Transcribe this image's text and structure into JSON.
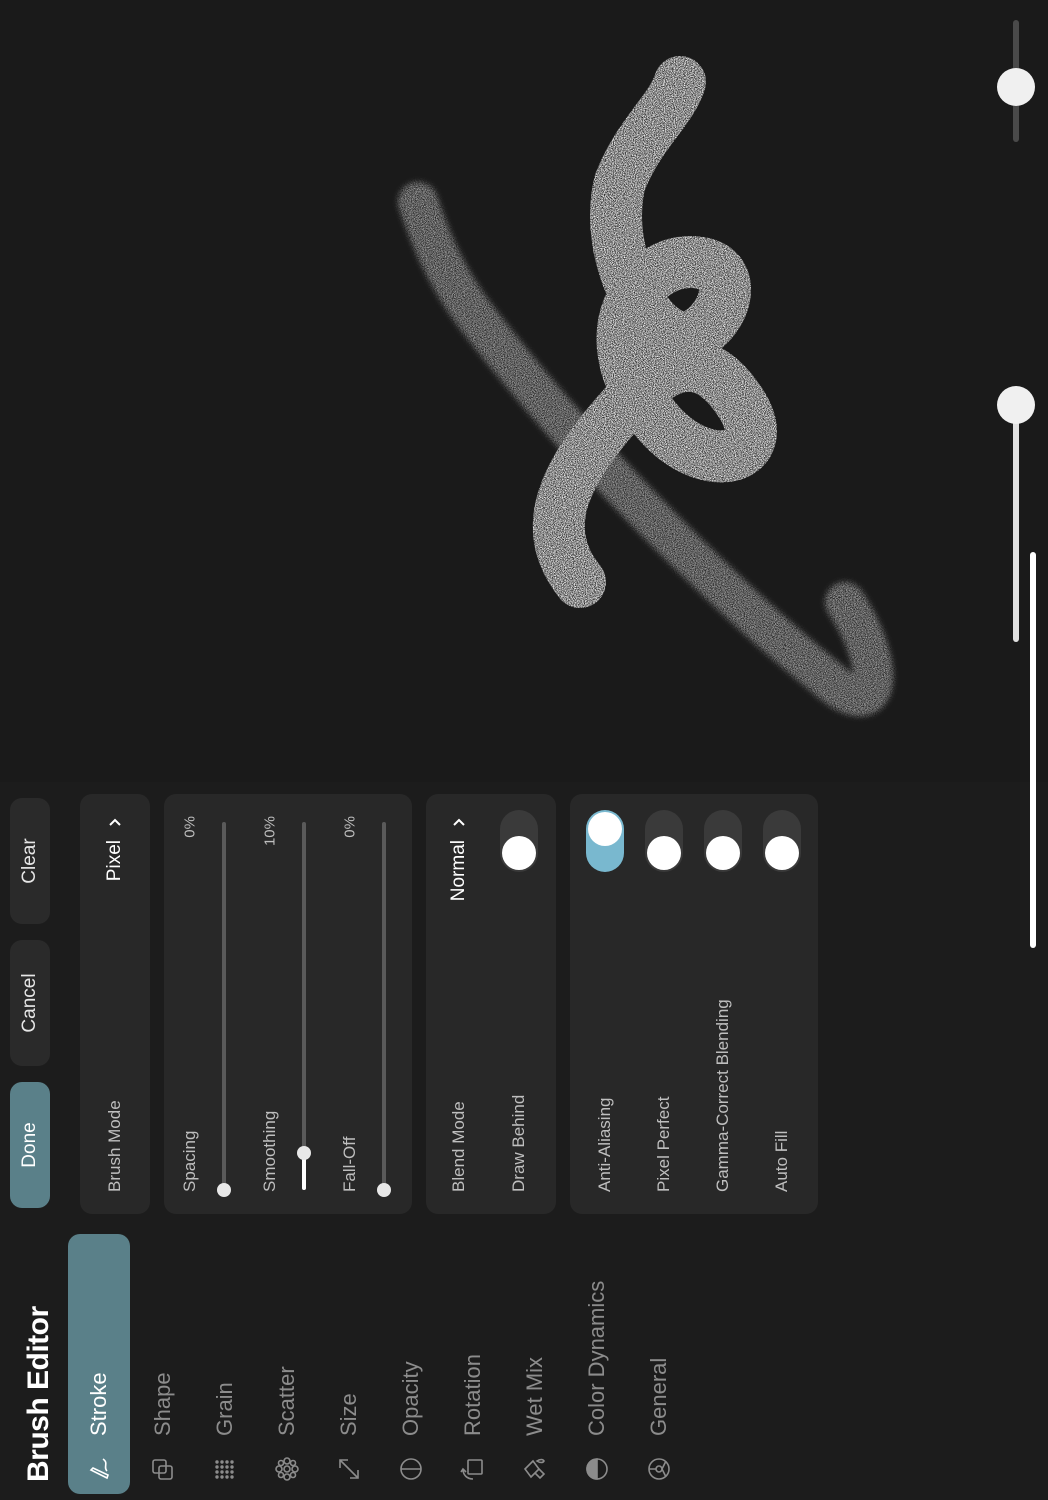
{
  "header": {
    "title": "Brush Editor"
  },
  "nav": {
    "items": [
      {
        "label": "Stroke",
        "icon": "stroke-icon",
        "active": true
      },
      {
        "label": "Shape",
        "icon": "shape-icon",
        "active": false
      },
      {
        "label": "Grain",
        "icon": "grain-icon",
        "active": false
      },
      {
        "label": "Scatter",
        "icon": "scatter-icon",
        "active": false
      },
      {
        "label": "Size",
        "icon": "size-icon",
        "active": false
      },
      {
        "label": "Opacity",
        "icon": "opacity-icon",
        "active": false
      },
      {
        "label": "Rotation",
        "icon": "rotation-icon",
        "active": false
      },
      {
        "label": "Wet Mix",
        "icon": "wet-mix-icon",
        "active": false
      },
      {
        "label": "Color Dynamics",
        "icon": "color-dynamics-icon",
        "active": false
      },
      {
        "label": "General",
        "icon": "general-icon",
        "active": false
      }
    ]
  },
  "actions": {
    "done": "Done",
    "cancel": "Cancel",
    "clear": "Clear"
  },
  "brush_mode": {
    "label": "Brush Mode",
    "value": "Pixel"
  },
  "stroke_settings": {
    "spacing": {
      "label": "Spacing",
      "value": "0%",
      "level": 0.0
    },
    "smoothing": {
      "label": "Smoothing",
      "value": "10%",
      "level": 0.1
    },
    "falloff": {
      "label": "Fall-Off",
      "value": "0%",
      "level": 0.0
    }
  },
  "blend": {
    "blend_mode": {
      "label": "Blend Mode",
      "value": "Normal"
    },
    "draw_behind": {
      "label": "Draw Behind",
      "on": false
    }
  },
  "toggles": [
    {
      "label": "Anti-Aliasing",
      "on": true
    },
    {
      "label": "Pixel Perfect",
      "on": false
    },
    {
      "label": "Gamma-Correct Blending",
      "on": false
    },
    {
      "label": "Auto Fill",
      "on": false
    }
  ],
  "colors": {
    "accent": "#5a8089",
    "toggle_on": "#79b8cf",
    "background": "#1c1c1c",
    "card": "#282828"
  }
}
